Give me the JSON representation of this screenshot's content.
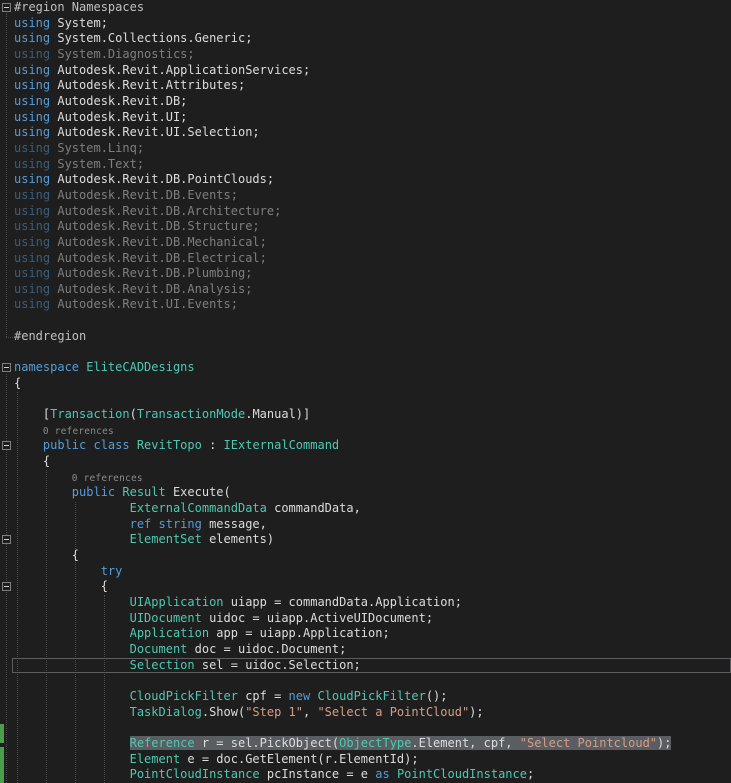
{
  "editor": {
    "colors": {
      "background": "#1e1e1e",
      "keyword": "#569cd6",
      "type": "#4ec9b0",
      "text": "#dcdcdc",
      "string": "#d69d85",
      "preprocessor": "#c0c0c0",
      "codelens": "#8a8a8a",
      "selection": "#5a5e62",
      "current_line_border": "#5d5d60",
      "change_bar": "#4b9e4b"
    },
    "codelens_label": "0 references",
    "lines": [
      {
        "fold": true,
        "tokens": [
          [
            "#region Namespaces",
            "preprocessor"
          ]
        ]
      },
      {
        "tokens": [
          [
            "using ",
            "keyword"
          ],
          [
            "System;",
            "text"
          ]
        ]
      },
      {
        "tokens": [
          [
            "using ",
            "keyword"
          ],
          [
            "System.Collections.Generic;",
            "text"
          ]
        ]
      },
      {
        "dim": true,
        "tokens": [
          [
            "using ",
            "keyword"
          ],
          [
            "System.Diagnostics;",
            "text"
          ]
        ]
      },
      {
        "tokens": [
          [
            "using ",
            "keyword"
          ],
          [
            "Autodesk.Revit.ApplicationServices;",
            "text"
          ]
        ]
      },
      {
        "tokens": [
          [
            "using ",
            "keyword"
          ],
          [
            "Autodesk.Revit.Attributes;",
            "text"
          ]
        ]
      },
      {
        "tokens": [
          [
            "using ",
            "keyword"
          ],
          [
            "Autodesk.Revit.DB;",
            "text"
          ]
        ]
      },
      {
        "tokens": [
          [
            "using ",
            "keyword"
          ],
          [
            "Autodesk.Revit.UI;",
            "text"
          ]
        ]
      },
      {
        "tokens": [
          [
            "using ",
            "keyword"
          ],
          [
            "Autodesk.Revit.UI.Selection;",
            "text"
          ]
        ]
      },
      {
        "dim": true,
        "tokens": [
          [
            "using ",
            "keyword"
          ],
          [
            "System.Linq;",
            "text"
          ]
        ]
      },
      {
        "dim": true,
        "tokens": [
          [
            "using ",
            "keyword"
          ],
          [
            "System.Text;",
            "text"
          ]
        ]
      },
      {
        "tokens": [
          [
            "using ",
            "keyword"
          ],
          [
            "Autodesk.Revit.DB.PointClouds;",
            "text"
          ]
        ]
      },
      {
        "dim": true,
        "tokens": [
          [
            "using ",
            "keyword"
          ],
          [
            "Autodesk.Revit.DB.Events;",
            "text"
          ]
        ]
      },
      {
        "dim": true,
        "tokens": [
          [
            "using ",
            "keyword"
          ],
          [
            "Autodesk.Revit.DB.Architecture;",
            "text"
          ]
        ]
      },
      {
        "dim": true,
        "tokens": [
          [
            "using ",
            "keyword"
          ],
          [
            "Autodesk.Revit.DB.Structure;",
            "text"
          ]
        ]
      },
      {
        "dim": true,
        "tokens": [
          [
            "using ",
            "keyword"
          ],
          [
            "Autodesk.Revit.DB.Mechanical;",
            "text"
          ]
        ]
      },
      {
        "dim": true,
        "tokens": [
          [
            "using ",
            "keyword"
          ],
          [
            "Autodesk.Revit.DB.Electrical;",
            "text"
          ]
        ]
      },
      {
        "dim": true,
        "tokens": [
          [
            "using ",
            "keyword"
          ],
          [
            "Autodesk.Revit.DB.Plumbing;",
            "text"
          ]
        ]
      },
      {
        "dim": true,
        "tokens": [
          [
            "using ",
            "keyword"
          ],
          [
            "Autodesk.Revit.DB.Analysis;",
            "text"
          ]
        ]
      },
      {
        "dim": true,
        "tokens": [
          [
            "using ",
            "keyword"
          ],
          [
            "Autodesk.Revit.UI.Events;",
            "text"
          ]
        ]
      },
      {
        "tokens": []
      },
      {
        "tokens": [
          [
            "#endregion",
            "preprocessor"
          ]
        ]
      },
      {
        "tokens": []
      },
      {
        "fold": true,
        "tokens": [
          [
            "namespace ",
            "keyword"
          ],
          [
            "EliteCADDesigns",
            "type"
          ]
        ]
      },
      {
        "tokens": [
          [
            "{",
            "text"
          ]
        ]
      },
      {
        "tokens": []
      },
      {
        "tokens": [
          [
            "    [",
            "text"
          ],
          [
            "Transaction",
            "type"
          ],
          [
            "(",
            "text"
          ],
          [
            "TransactionMode",
            "type"
          ],
          [
            ".Manual)]",
            "text"
          ]
        ]
      },
      {
        "codelens": true,
        "pad": 4
      },
      {
        "fold": true,
        "tokens": [
          [
            "    ",
            "text"
          ],
          [
            "public class ",
            "keyword"
          ],
          [
            "RevitTopo",
            "type"
          ],
          [
            " : ",
            "text"
          ],
          [
            "IExternalCommand",
            "type"
          ]
        ]
      },
      {
        "tokens": [
          [
            "    {",
            "text"
          ]
        ]
      },
      {
        "codelens": true,
        "pad": 8
      },
      {
        "tokens": [
          [
            "        ",
            "text"
          ],
          [
            "public ",
            "keyword"
          ],
          [
            "Result",
            "type"
          ],
          [
            " Execute(",
            "text"
          ]
        ]
      },
      {
        "tokens": [
          [
            "                ",
            "text"
          ],
          [
            "ExternalCommandData ",
            "type"
          ],
          [
            "commandData,",
            "text"
          ]
        ]
      },
      {
        "tokens": [
          [
            "                ",
            "text"
          ],
          [
            "ref ",
            "keyword"
          ],
          [
            "string ",
            "keyword"
          ],
          [
            "message,",
            "text"
          ]
        ]
      },
      {
        "fold": true,
        "tokens": [
          [
            "                ",
            "text"
          ],
          [
            "ElementSet ",
            "type"
          ],
          [
            "elements)",
            "text"
          ]
        ]
      },
      {
        "tokens": [
          [
            "        {",
            "text"
          ]
        ]
      },
      {
        "tokens": [
          [
            "            ",
            "text"
          ],
          [
            "try",
            "keyword"
          ]
        ]
      },
      {
        "fold": true,
        "tokens": [
          [
            "            {",
            "text"
          ]
        ]
      },
      {
        "tokens": [
          [
            "                ",
            "text"
          ],
          [
            "UIApplication ",
            "type"
          ],
          [
            "uiapp = commandData.Application;",
            "text"
          ]
        ]
      },
      {
        "tokens": [
          [
            "                ",
            "text"
          ],
          [
            "UIDocument ",
            "type"
          ],
          [
            "uidoc = uiapp.ActiveUIDocument;",
            "text"
          ]
        ]
      },
      {
        "tokens": [
          [
            "                ",
            "text"
          ],
          [
            "Application ",
            "type"
          ],
          [
            "app = uiapp.Application;",
            "text"
          ]
        ]
      },
      {
        "tokens": [
          [
            "                ",
            "text"
          ],
          [
            "Document ",
            "type"
          ],
          [
            "doc = uidoc.Document;",
            "text"
          ]
        ]
      },
      {
        "current": true,
        "tokens": [
          [
            "                ",
            "text"
          ],
          [
            "Selection ",
            "type"
          ],
          [
            "sel = uidoc.Selection;",
            "text"
          ]
        ]
      },
      {
        "tokens": []
      },
      {
        "tokens": [
          [
            "                ",
            "text"
          ],
          [
            "CloudPickFilter ",
            "type"
          ],
          [
            "cpf = ",
            "text"
          ],
          [
            "new ",
            "keyword"
          ],
          [
            "CloudPickFilter",
            "type"
          ],
          [
            "();",
            "text"
          ]
        ]
      },
      {
        "tokens": [
          [
            "                ",
            "text"
          ],
          [
            "TaskDialog",
            "type"
          ],
          [
            ".Show(",
            "text"
          ],
          [
            "\"Step 1\"",
            "string"
          ],
          [
            ", ",
            "text"
          ],
          [
            "\"Select a PointCloud\"",
            "string"
          ],
          [
            ");",
            "text"
          ]
        ]
      },
      {
        "tokens": []
      },
      {
        "sel": true,
        "selStart": 1,
        "tokens": [
          [
            "                ",
            "text"
          ],
          [
            "Reference ",
            "type"
          ],
          [
            "r = sel.PickObject(",
            "text"
          ],
          [
            "ObjectType",
            "type"
          ],
          [
            ".Element, cpf, ",
            "text"
          ],
          [
            "\"Select Pointcloud\"",
            "string"
          ],
          [
            ");",
            "text"
          ]
        ]
      },
      {
        "tokens": [
          [
            "                ",
            "text"
          ],
          [
            "Element ",
            "type"
          ],
          [
            "e = doc.GetElement(r.ElementId);",
            "text"
          ]
        ]
      },
      {
        "tokens": [
          [
            "                ",
            "text"
          ],
          [
            "PointCloudInstance ",
            "type"
          ],
          [
            "pcInstance = e ",
            "text"
          ],
          [
            "as ",
            "keyword"
          ],
          [
            "PointCloudInstance",
            "type"
          ],
          [
            ";",
            "text"
          ]
        ]
      }
    ]
  }
}
